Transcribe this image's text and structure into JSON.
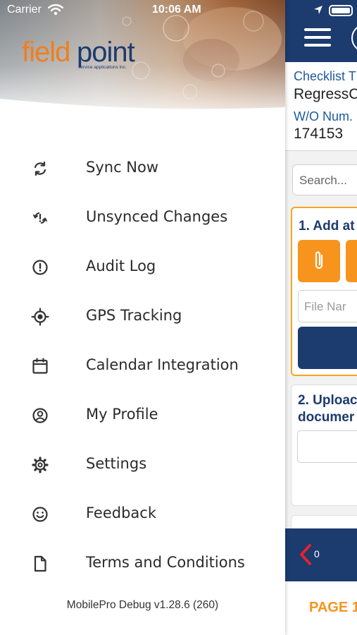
{
  "status_bar": {
    "carrier": "Carrier",
    "time": "10:06 AM"
  },
  "brand": {
    "logo_part1": "field",
    "logo_part2": "point",
    "tagline": "service applications inc.",
    "orange": "#f07f1d",
    "navy": "#1c3b6e"
  },
  "drawer": {
    "items": [
      {
        "label": "Sync Now",
        "icon": "sync-icon"
      },
      {
        "label": "Unsynced Changes",
        "icon": "unsynced-icon"
      },
      {
        "label": "Audit Log",
        "icon": "alert-circle-icon"
      },
      {
        "label": "GPS Tracking",
        "icon": "gps-icon"
      },
      {
        "label": "Calendar Integration",
        "icon": "calendar-icon"
      },
      {
        "label": "My Profile",
        "icon": "profile-icon"
      },
      {
        "label": "Settings",
        "icon": "gear-icon"
      },
      {
        "label": "Feedback",
        "icon": "smiley-icon"
      },
      {
        "label": "Terms and Conditions",
        "icon": "document-icon"
      }
    ],
    "version": "MobilePro Debug v1.28.6 (260)"
  },
  "app": {
    "checklist_label": "Checklist T",
    "checklist_value": "RegressC",
    "wo_label": "W/O Num.",
    "wo_value": "174153",
    "search_placeholder": "Search...",
    "card1_title": "1. Add at",
    "file_name_placeholder": "File Nar",
    "card2_title_line1": "2. Uploac",
    "card2_title_line2": "documer",
    "back_count": "0",
    "page_label": "PAGE 1"
  }
}
